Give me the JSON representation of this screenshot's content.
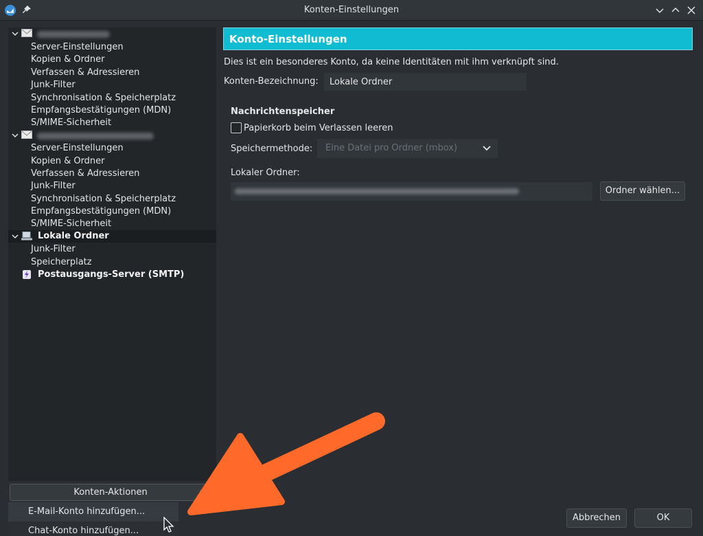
{
  "window": {
    "title": "Konten-Einstellungen"
  },
  "sidebar": {
    "account1": {
      "items": [
        "Server-Einstellungen",
        "Kopien & Ordner",
        "Verfassen & Adressieren",
        "Junk-Filter",
        "Synchronisation & Speicherplatz",
        "Empfangsbestätigungen (MDN)",
        "S/MIME-Sicherheit"
      ]
    },
    "account2": {
      "items": [
        "Server-Einstellungen",
        "Kopien & Ordner",
        "Verfassen & Adressieren",
        "Junk-Filter",
        "Synchronisation & Speicherplatz",
        "Empfangsbestätigungen (MDN)",
        "S/MIME-Sicherheit"
      ]
    },
    "local": {
      "label": "Lokale Ordner",
      "items": [
        "Junk-Filter",
        "Speicherplatz"
      ]
    },
    "smtp": {
      "label": "Postausgangs-Server (SMTP)"
    },
    "actions_label": "Konten-Aktionen",
    "popup": {
      "add_email": "E-Mail-Konto hinzufügen...",
      "add_chat": "Chat-Konto hinzufügen..."
    }
  },
  "main": {
    "header": "Konto-Einstellungen",
    "intro": "Dies ist ein besonderes Konto, da keine Identitäten mit ihm verknüpft sind.",
    "name_label": "Konten-Bezeichnung:",
    "name_value": "Lokale Ordner",
    "section_title": "Nachrichtenspeicher",
    "empty_trash_label": "Papierkorb beim Verlassen leeren",
    "storage_label": "Speichermethode:",
    "storage_value": "Eine Datei pro Ordner (mbox)",
    "local_dir_label": "Lokaler Ordner:",
    "choose_dir_button": "Ordner wählen...",
    "cancel_button": "Abbrechen",
    "ok_button": "OK"
  },
  "colors": {
    "header_accent": "#0fbcd2",
    "annotation_arrow": "#ff6a2a"
  }
}
